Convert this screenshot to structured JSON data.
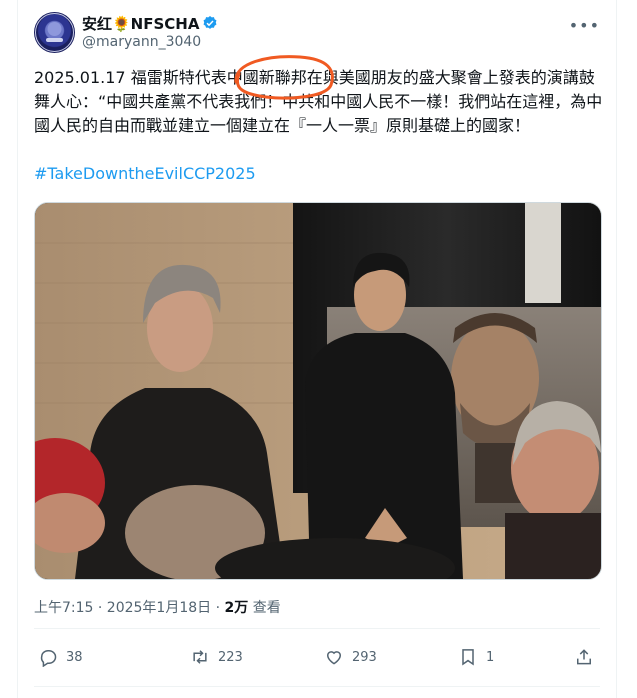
{
  "tweet": {
    "display_name": "安红🌻NFSCHA",
    "handle": "@maryann_3040",
    "text": "2025.01.17 福雷斯特代表中國新聯邦在與美國朋友的盛大聚會上發表的演講鼓舞人心：“中國共產黨不代表我們！中共和中國人民不一樣！我們站在這裡，為中國人民的自由而戰並建立一個建立在『一人一票』原則基礎上的國家！",
    "hashtag": "#TakeDowntheEvilCCP2025",
    "time": "上午7:15 · 2025年1月18日 · ",
    "views_count": "2万",
    "views_label": " 查看"
  },
  "actions": {
    "replies": "38",
    "retweets": "223",
    "likes": "293",
    "bookmarks": "1"
  },
  "icons": [
    "verified-badge-icon",
    "more-icon",
    "reply-icon",
    "retweet-icon",
    "like-icon",
    "bookmark-icon",
    "share-icon"
  ],
  "colors": {
    "link": "#1d9bf0",
    "verified": "#1d9bf0",
    "secondary": "#536471",
    "annotation": "#f05a22"
  }
}
